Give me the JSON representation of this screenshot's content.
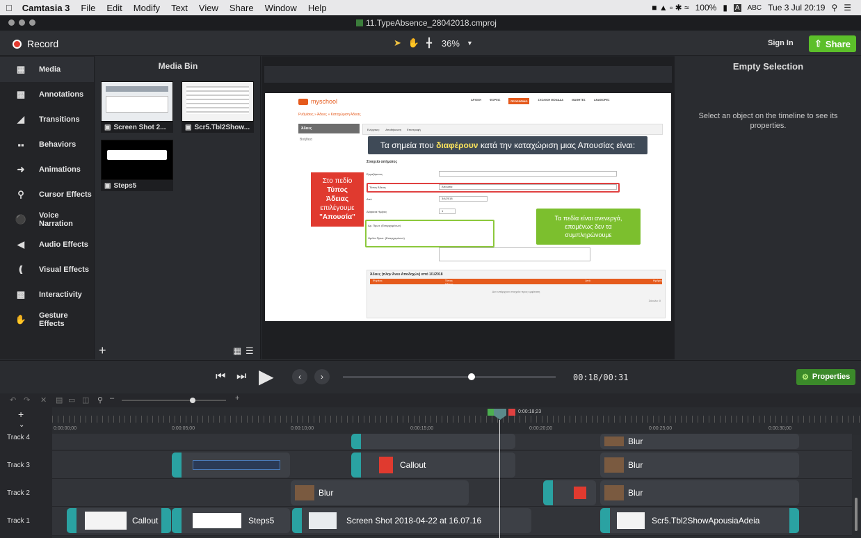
{
  "menubar": {
    "app": "Camtasia 3",
    "items": [
      "File",
      "Edit",
      "Modify",
      "Text",
      "View",
      "Share",
      "Window",
      "Help"
    ],
    "battery": "100%",
    "input": "ABC",
    "clock": "Tue 3 Jul 20:19"
  },
  "window": {
    "title": "11.TypeAbsence_28042018.cmproj"
  },
  "toolbar": {
    "record": "Record",
    "zoom": "36%",
    "sign_in": "Sign In",
    "share": "Share"
  },
  "nav": [
    {
      "label": "Media",
      "icon": "film-icon"
    },
    {
      "label": "Annotations",
      "icon": "annotation-icon"
    },
    {
      "label": "Transitions",
      "icon": "transition-icon"
    },
    {
      "label": "Behaviors",
      "icon": "behavior-icon"
    },
    {
      "label": "Animations",
      "icon": "animation-icon"
    },
    {
      "label": "Cursor Effects",
      "icon": "cursor-icon"
    },
    {
      "label": "Voice Narration",
      "icon": "microphone-icon"
    },
    {
      "label": "Audio Effects",
      "icon": "speaker-icon"
    },
    {
      "label": "Visual Effects",
      "icon": "wand-icon"
    },
    {
      "label": "Interactivity",
      "icon": "interactive-icon"
    },
    {
      "label": "Gesture Effects",
      "icon": "gesture-icon"
    }
  ],
  "mediabin": {
    "title": "Media Bin",
    "items": [
      "Screen Shot 2...",
      "Scr5.Tbl2Show...",
      "Steps5"
    ]
  },
  "properties": {
    "title": "Empty Selection",
    "hint": "Select an object on the timeline to see its properties.",
    "button": "Properties"
  },
  "playback": {
    "time": "00:18/00:31"
  },
  "ruler": {
    "ticks": [
      "0:00:00;00",
      "0:00:05;00",
      "0:00:10;00",
      "0:00:15;00",
      "0:00:20;00",
      "0:00:25;00",
      "0:00:30;00"
    ],
    "playhead": "0:00:18;23"
  },
  "tracks": {
    "labels": [
      "Track 4",
      "Track 3",
      "Track 2",
      "Track 1"
    ],
    "t4": {
      "c2": "Blur"
    },
    "t3": {
      "c2": "Callout",
      "c3": "Blur"
    },
    "t2": {
      "c1": "Blur",
      "c3": "Blur"
    },
    "t1": {
      "c1": "Callout",
      "c2": "Steps5",
      "c3": "Screen Shot 2018-04-22 at 16.07.16",
      "c4": "Scr5.Tbl2ShowApousiaAdeia"
    }
  },
  "slide": {
    "logo": "myschool",
    "nav": [
      "ΑΡΧΙΚΗ",
      "ΦΟΡΕΙΣ",
      "ΠΡΟΣΩΠΙΚΟ",
      "ΣΧΟΛΙΚΗ ΜΟΝΑΔΑ",
      "ΜΑΘΗΤΕΣ",
      "ΑΝΑΦΟΡΕΣ"
    ],
    "breadcrumb": "Ρυθμίσεις » Άδειες » Καταχώριση Άδειας",
    "side_title": "Άδειες",
    "side_help": "Βοήθεια",
    "actions": "Ενέργειες:",
    "save": "Αποθήκευση",
    "back": "Επιστροφή",
    "banner": "Τα σημεία που διαφέρουν κατά την καταχώριση μιας Απουσίας είναι:",
    "banner_pre": "Τα σημεία που ",
    "banner_bold": "διαφέρουν",
    "banner_post": " κατά την καταχώριση μιας Απουσίας είναι:",
    "section": "Στοιχεία αιτήματος",
    "fields": [
      "Εργαζόμενος",
      "Τύπος Άδειας",
      "Από",
      "Διάρκεια Ημέρες",
      "Αρ. Πρωτ. (Εισερχομένων)",
      "Ημ/νία Πρωτ. (Εισερχομένων)",
      "Παρατηρήσεις Αίτησης"
    ],
    "type_value": "Απουσία",
    "date_value": "3/4/2018",
    "days_value": "1",
    "red_callout": [
      "Στο πεδίο",
      "Τύπος",
      "Άδειας",
      "επιλέγουμε",
      "\"Απουσία\""
    ],
    "green_callout": [
      "Τα πεδία είναι ανενεργά,",
      "επομένως δεν τα",
      "συμπληρώνουμε"
    ],
    "table_title": "Άδειες (πλην Άνευ Αποδοχών) από 1/1/2018",
    "table_cols": [
      "Φορέας",
      "Τύπος Άδειας",
      "Από",
      "Ημέρες"
    ],
    "table_empty": "Δεν υπάρχουν στοιχεία προς εμφάνιση",
    "table_footer": "Σύνολο: 0"
  }
}
